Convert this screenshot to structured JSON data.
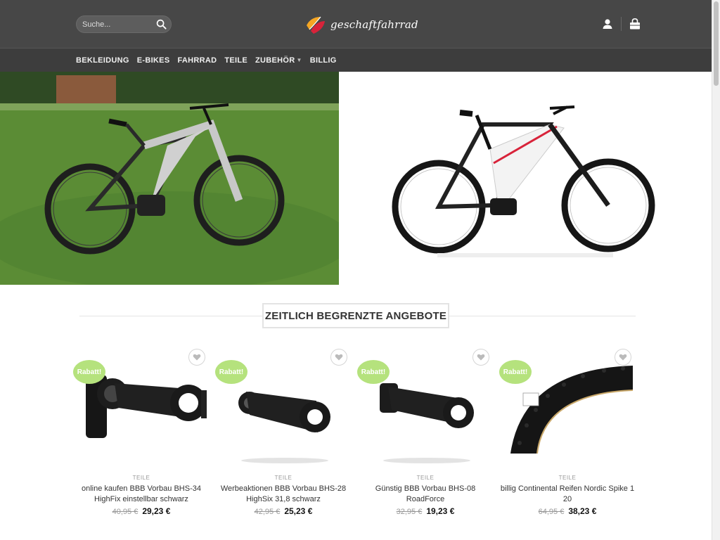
{
  "header": {
    "search_placeholder": "Suche...",
    "logo_text": "geschaftfahrrad",
    "icons": [
      "search-icon",
      "user-icon",
      "cart-icon"
    ]
  },
  "nav": {
    "items": [
      {
        "label": "BEKLEIDUNG"
      },
      {
        "label": "E-BIKES"
      },
      {
        "label": "FAHRRAD"
      },
      {
        "label": "TEILE"
      },
      {
        "label": "ZUBEHÖR"
      },
      {
        "label": "BILLIG"
      }
    ]
  },
  "section": {
    "title": "ZEITLICH BEGRENZTE ANGEBOTE"
  },
  "products": [
    {
      "badge": "Rabatt!",
      "category": "TEILE",
      "name": "online kaufen BBB Vorbau BHS-34 HighFix einstellbar schwarz",
      "old_price": "40,95 €",
      "price": "29,23 €",
      "image": "stem-adjustable"
    },
    {
      "badge": "Rabatt!",
      "category": "TEILE",
      "name": "Werbeaktionen BBB Vorbau BHS-28 HighSix 31,8 schwarz",
      "old_price": "42,95 €",
      "price": "25,23 €",
      "image": "stem"
    },
    {
      "badge": "Rabatt!",
      "category": "TEILE",
      "name": "Günstig BBB Vorbau BHS-08 RoadForce",
      "old_price": "32,95 €",
      "price": "19,23 €",
      "image": "stem-road"
    },
    {
      "badge": "Rabatt!",
      "category": "TEILE",
      "name": "billig Continental Reifen Nordic Spike 1 20",
      "old_price": "64,95 €",
      "price": "38,23 €",
      "image": "tire"
    }
  ],
  "colors": {
    "header_bg": "#474747",
    "nav_bg": "#3d3d3d",
    "badge": "#b5e27d",
    "logo_orange": "#f5a623",
    "logo_red": "#d8233a"
  }
}
